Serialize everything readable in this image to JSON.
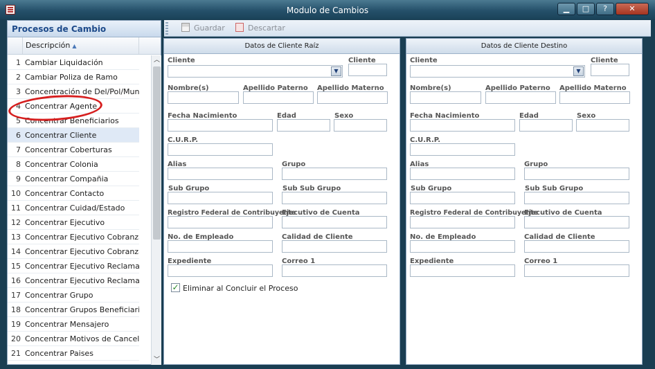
{
  "window": {
    "title": "Modulo de Cambios",
    "buttons": {
      "minimize": "▁",
      "maximize": "□",
      "help": "?",
      "close": "✕"
    }
  },
  "sidebar": {
    "title": "Procesos de Cambio",
    "column_header": "Descripción",
    "items": [
      {
        "num": "1",
        "label": "Cambiar Liquidación"
      },
      {
        "num": "2",
        "label": "Cambiar Poliza de Ramo"
      },
      {
        "num": "3",
        "label": "Concentración de Del/Pol/Mun"
      },
      {
        "num": "4",
        "label": "Concentrar Agente"
      },
      {
        "num": "5",
        "label": "Concentrar Beneficiarios"
      },
      {
        "num": "6",
        "label": "Concentrar Cliente"
      },
      {
        "num": "7",
        "label": "Concentrar Coberturas"
      },
      {
        "num": "8",
        "label": "Concentrar Colonia"
      },
      {
        "num": "9",
        "label": "Concentrar Compañia"
      },
      {
        "num": "10",
        "label": "Concentrar Contacto"
      },
      {
        "num": "11",
        "label": "Concentrar Cuidad/Estado"
      },
      {
        "num": "12",
        "label": "Concentrar Ejecutivo"
      },
      {
        "num": "13",
        "label": "Concentrar Ejecutivo Cobranza"
      },
      {
        "num": "14",
        "label": "Concentrar Ejecutivo Cobranza"
      },
      {
        "num": "15",
        "label": "Concentrar Ejecutivo Reclamaciones"
      },
      {
        "num": "16",
        "label": "Concentrar Ejecutivo Reclamaciones"
      },
      {
        "num": "17",
        "label": "Concentrar Grupo"
      },
      {
        "num": "18",
        "label": "Concentrar Grupos Beneficiarios"
      },
      {
        "num": "19",
        "label": "Concentrar Mensajero"
      },
      {
        "num": "20",
        "label": "Concentrar Motivos de Cancelación"
      },
      {
        "num": "21",
        "label": "Concentrar Paises"
      }
    ],
    "selected_index": 5
  },
  "toolbar": {
    "save_label": "Guardar",
    "discard_label": "Descartar"
  },
  "fields": {
    "cliente": "Cliente",
    "cliente_id": "Cliente",
    "nombres": "Nombre(s)",
    "apellido_paterno": "Apellido Paterno",
    "apellido_materno": "Apellido Materno",
    "fecha_nacimiento": "Fecha Nacimiento",
    "edad": "Edad",
    "sexo": "Sexo",
    "curp": "C.U.R.P.",
    "alias": "Alias",
    "grupo": "Grupo",
    "sub_grupo": "Sub Grupo",
    "sub_sub_grupo": "Sub Sub Grupo",
    "rfc": "Registro Federal de Contribuyente",
    "ejecutivo_cuenta": "Ejecutivo de Cuenta",
    "no_empleado": "No. de Empleado",
    "calidad_cliente": "Calidad de Cliente",
    "expediente": "Expediente",
    "correo": "Correo 1"
  },
  "panel_origin": {
    "title": "Datos de Cliente Raíz",
    "checkbox_label": "Eliminar al Concluir el Proceso",
    "checkbox_checked": "✓"
  },
  "panel_destination": {
    "title": "Datos de Cliente Destino"
  }
}
